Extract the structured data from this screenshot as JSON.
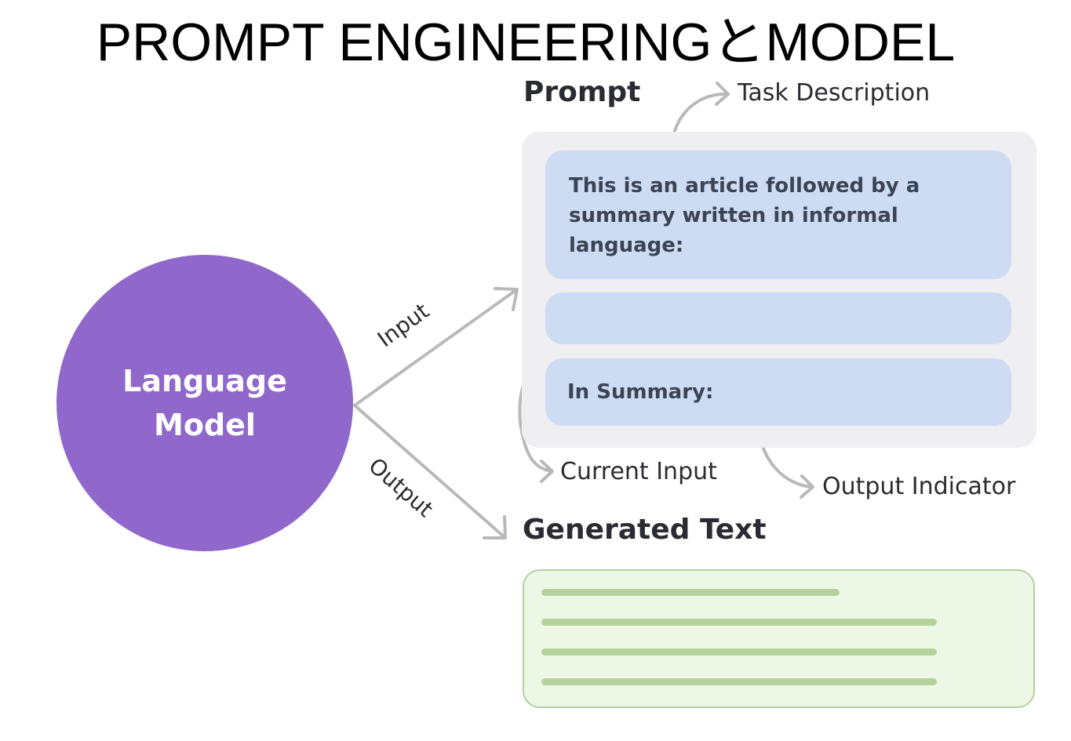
{
  "title": "PROMPT ENGINEERINGとMODEL",
  "language_model": {
    "lines": [
      "Language",
      "Model"
    ]
  },
  "edges": {
    "input": "Input",
    "output": "Output"
  },
  "prompt": {
    "heading": "Prompt",
    "task_text": "This is an article followed by a summary written in informal language:",
    "indicator_text": "In Summary:"
  },
  "callouts": {
    "task_description": "Task Description",
    "current_input": "Current Input",
    "output_indicator": "Output Indicator"
  },
  "generated": {
    "heading": "Generated Text",
    "placeholder_line_count": 4
  },
  "colors": {
    "circle": "#9068cc",
    "prompt_container": "#efeff2",
    "prompt_block": "#cedcf3",
    "generated_fill": "#edf7e6",
    "generated_border": "#b4cfa0",
    "generated_line": "#b5d29c",
    "arrow": "#b9b9b9"
  }
}
